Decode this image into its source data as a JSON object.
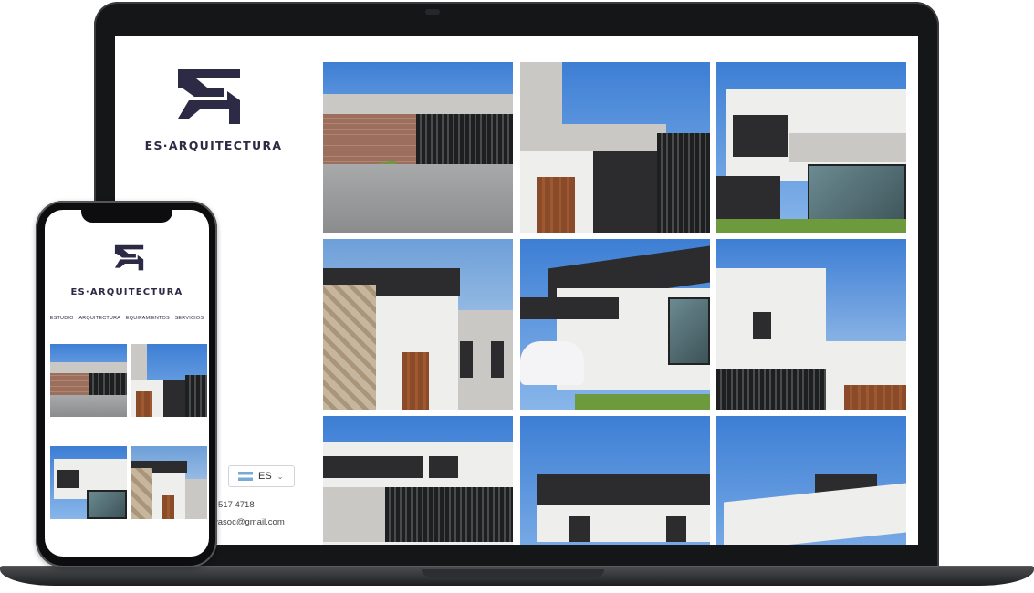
{
  "brand": {
    "name": "ES·ARQUITECTURA"
  },
  "desktop": {
    "language": "ES",
    "phone": "517 4718",
    "email": "yasoc@gmail.com"
  },
  "mobile": {
    "nav": [
      "ESTUDIO",
      "ARQUITECTURA",
      "EQUIPAMIENTOS",
      "SERVICIOS"
    ]
  },
  "colors": {
    "brand": "#2c2a45",
    "device": "#151618"
  },
  "icons": [
    "logo-icon",
    "argentina-flag-icon",
    "chevron-down-icon"
  ],
  "gallery_count": 9
}
